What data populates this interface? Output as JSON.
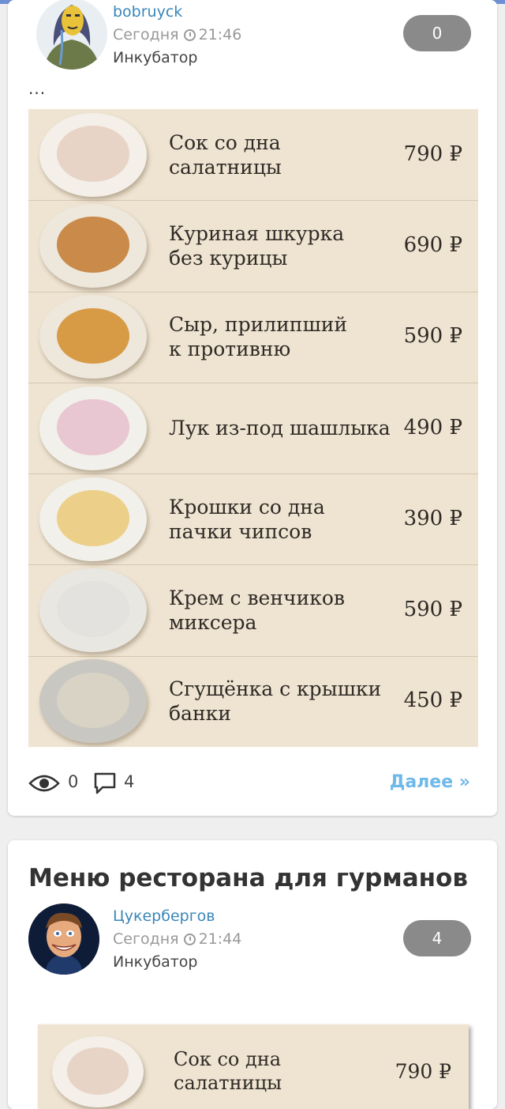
{
  "colors": {
    "accent": "#3a86b8",
    "link": "#6fb8ea",
    "badge": "#8a8a8a",
    "menu_bg": "#efe4d2"
  },
  "posts": [
    {
      "author": "bobruyck",
      "date": "Сегодня",
      "time": "21:46",
      "section": "Инкубатор",
      "rating": "0",
      "excerpt": "...",
      "menu": [
        {
          "name": "Сок со дна\nсалатницы",
          "price": "790 ₽",
          "dish": "soup"
        },
        {
          "name": "Куриная шкурка\nбез курицы",
          "price": "690 ₽",
          "dish": "chips"
        },
        {
          "name": "Сыр, прилипший\nк противню",
          "price": "590 ₽",
          "dish": "cheese"
        },
        {
          "name": "Лук из-под шашлыка",
          "price": "490 ₽",
          "dish": "onion"
        },
        {
          "name": "Крошки со дна\nпачки чипсов",
          "price": "390 ₽",
          "dish": "crumbs"
        },
        {
          "name": "Крем с венчиков\nмиксера",
          "price": "590 ₽",
          "dish": "whisk"
        },
        {
          "name": "Сгущёнка с крышки\nбанки",
          "price": "450 ₽",
          "dish": "lid"
        }
      ],
      "views": "0",
      "comments": "4",
      "more_label": "Далее »"
    },
    {
      "title": "Меню ресторана для гурманов",
      "author": "Цукербергов",
      "date": "Сегодня",
      "time": "21:44",
      "section": "Инкубатор",
      "rating": "4",
      "menu": [
        {
          "name": "Сок со дна\nсалатницы",
          "price": "790 ₽",
          "dish": "soup"
        }
      ]
    }
  ],
  "icons": {
    "views": "eye-icon",
    "comments": "comment-icon",
    "time": "clock-icon"
  }
}
